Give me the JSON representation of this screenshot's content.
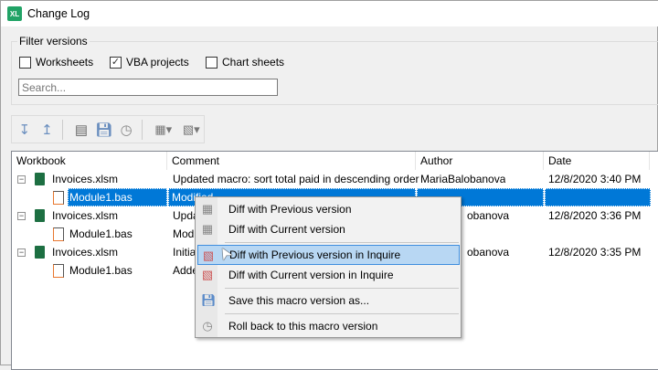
{
  "window": {
    "title": "Change Log",
    "app_badge": "XL"
  },
  "filter": {
    "group_label": "Filter versions",
    "checkboxes": [
      {
        "label": "Worksheets",
        "checked": false
      },
      {
        "label": "VBA projects",
        "checked": true
      },
      {
        "label": "Chart sheets",
        "checked": false
      }
    ],
    "search_placeholder": "Search...",
    "search_value": ""
  },
  "toolbar": {
    "icons": [
      "expand-all-icon",
      "collapse-all-icon",
      "view-workbook-icon",
      "save-icon",
      "rollback-icon",
      "diff-dropdown-icon",
      "inquire-diff-dropdown-icon"
    ]
  },
  "tree": {
    "columns": [
      "Workbook",
      "Comment",
      "Author",
      "Date"
    ],
    "rows": [
      {
        "workbook": "Invoices.xlsm",
        "comment": "Updated macro: sort total paid in descending order",
        "author": "MariaBalobanova",
        "date": "12/8/2020 3:40 PM",
        "level": 0
      },
      {
        "workbook": "Module1.bas",
        "comment": "Modified",
        "author": "",
        "date": "",
        "level": 1,
        "selected": true
      },
      {
        "workbook": "Invoices.xlsm",
        "comment": "Upda",
        "author": "obanova",
        "date": "12/8/2020 3:36 PM",
        "level": 0
      },
      {
        "workbook": "Module1.bas",
        "comment": "Modi",
        "author": "",
        "date": "",
        "level": 1
      },
      {
        "workbook": "Invoices.xlsm",
        "comment": "Initia",
        "author": "obanova",
        "date": "12/8/2020 3:35 PM",
        "level": 0
      },
      {
        "workbook": "Module1.bas",
        "comment": "Adde",
        "author": "",
        "date": "",
        "level": 1
      }
    ]
  },
  "context_menu": {
    "items": [
      {
        "label": "Diff with Previous version",
        "icon": "grid-diff-icon"
      },
      {
        "label": "Diff with Current version",
        "icon": "grid-diff-icon"
      },
      {
        "label": "Diff with Previous version in Inquire",
        "icon": "inquire-diff-icon",
        "highlighted": true
      },
      {
        "label": "Diff with Current version in Inquire",
        "icon": "inquire-diff-icon"
      },
      {
        "label": "Save this macro version as...",
        "icon": "save-icon"
      },
      {
        "label": "Roll back to this macro version",
        "icon": "rollback-icon"
      }
    ]
  },
  "colors": {
    "selection": "#0078d7",
    "menu_highlight": "#b8d7f3",
    "excel_green": "#21a366"
  }
}
